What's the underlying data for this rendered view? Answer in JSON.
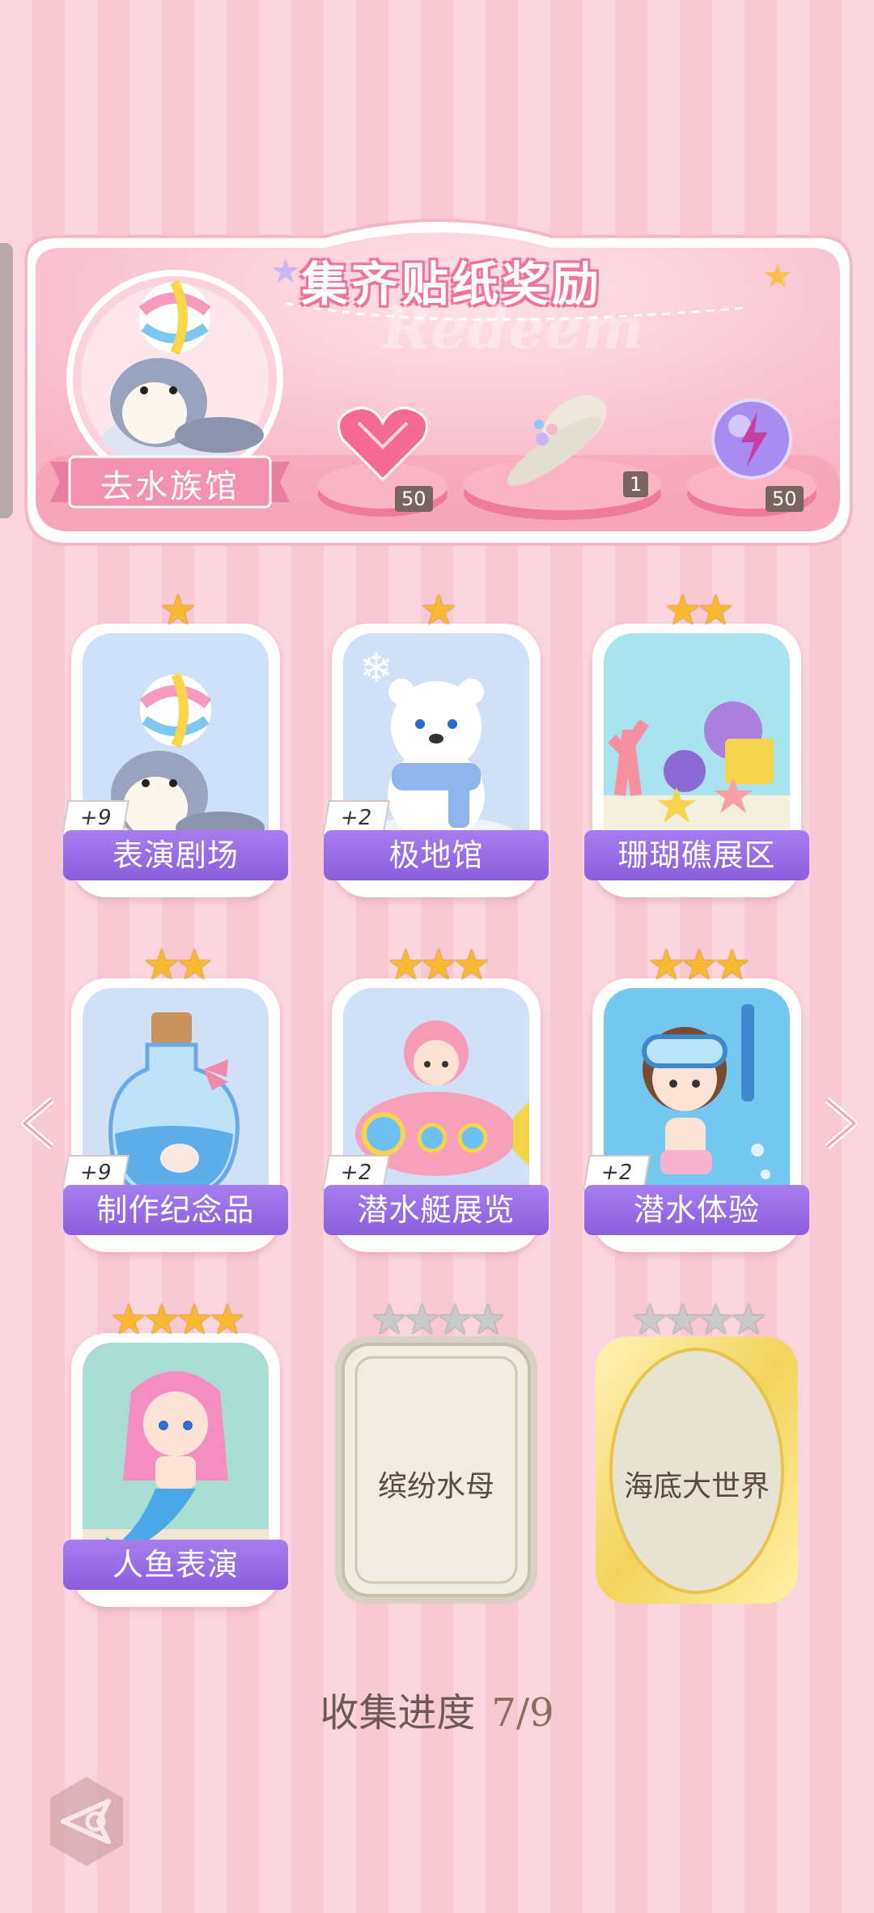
{
  "banner": {
    "title": "集齐贴纸奖励",
    "watermark": "Redeem",
    "aquarium_button": "去水族馆",
    "rewards": [
      {
        "icon": "heart-gem-icon",
        "count": "50"
      },
      {
        "icon": "flower-hat-icon",
        "count": "1"
      },
      {
        "icon": "lightning-orb-icon",
        "count": "50"
      }
    ]
  },
  "cards": [
    {
      "label": "表演剧场",
      "stars": 1,
      "badge": "+9",
      "icon": "seal-with-ball"
    },
    {
      "label": "极地馆",
      "stars": 1,
      "badge": "+2",
      "icon": "polar-bear"
    },
    {
      "label": "珊瑚礁展区",
      "stars": 2,
      "badge": "",
      "icon": "coral-reef"
    },
    {
      "label": "制作纪念品",
      "stars": 2,
      "badge": "+9",
      "icon": "bottle-souvenir"
    },
    {
      "label": "潜水艇展览",
      "stars": 3,
      "badge": "+2",
      "icon": "submarine-girl"
    },
    {
      "label": "潜水体验",
      "stars": 3,
      "badge": "+2",
      "icon": "diver-girl"
    },
    {
      "label": "人鱼表演",
      "stars": 4,
      "badge": "",
      "icon": "mermaid"
    }
  ],
  "locked_cards": [
    {
      "label": "缤纷水母",
      "stars": 4
    },
    {
      "label": "海底大世界",
      "stars": 4
    }
  ],
  "progress": {
    "label": "收集进度",
    "value": "7/9"
  },
  "colors": {
    "accent_purple": "#8a5edc",
    "star_gold": "#f7b930",
    "banner_pink": "#f7a8bd"
  }
}
